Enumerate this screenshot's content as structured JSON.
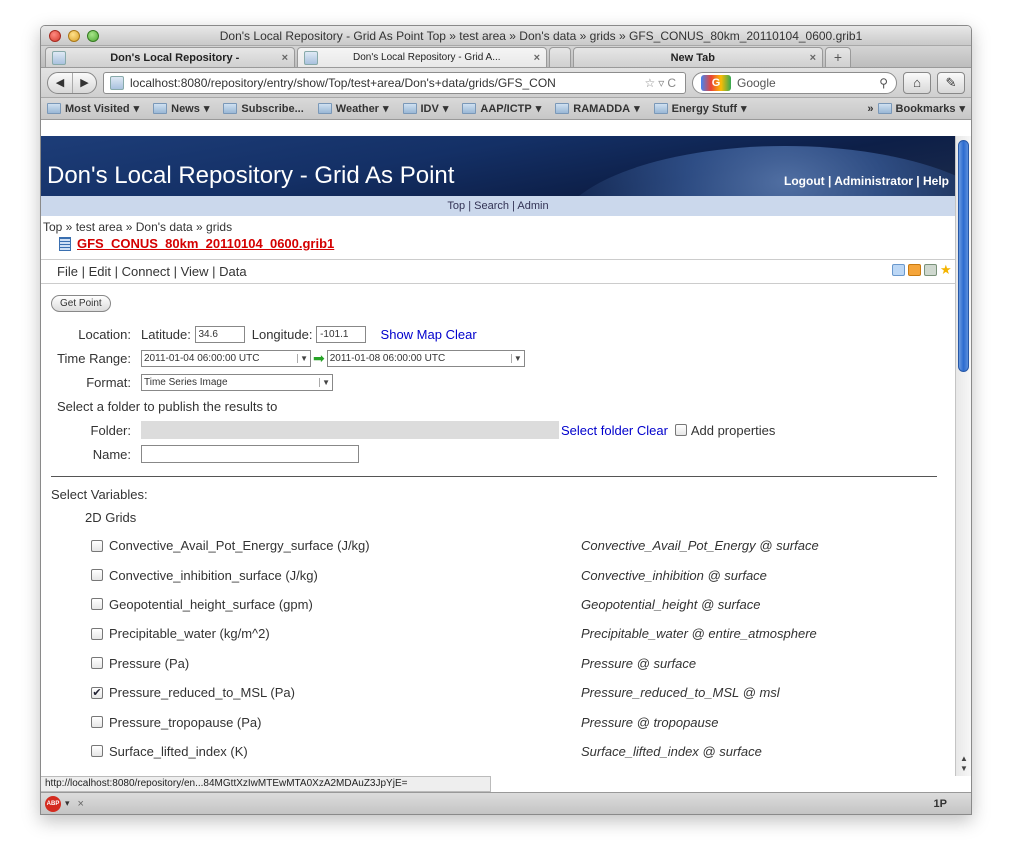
{
  "window": {
    "title": "Don's Local Repository - Grid As Point Top » test area » Don's data » grids » GFS_CONUS_80km_20110104_0600.grib1"
  },
  "tabs": [
    {
      "label": "Don's Local Repository -",
      "active": false
    },
    {
      "label": "Don's Local Repository - Grid A...",
      "active": true
    },
    {
      "label": "New Tab",
      "active": false
    }
  ],
  "nav": {
    "url": "localhost:8080/repository/entry/show/Top/test+area/Don's+data/grids/GFS_CON",
    "search_placeholder": "Google",
    "search_engine": "G"
  },
  "bookmarks": [
    "Most Visited",
    "News",
    "Subscribe...",
    "Weather",
    "IDV",
    "AAP/ICTP",
    "RAMADDA",
    "Energy Stuff"
  ],
  "bookmarks_overflow": "Bookmarks",
  "page": {
    "banner_title": "Don's Local Repository - Grid As Point",
    "banner_links": [
      "Logout",
      "Administrator",
      "Help"
    ],
    "top_menu": [
      "Top",
      "Search",
      "Admin"
    ],
    "breadcrumbs": "Top » test area » Don's data » grids",
    "entry_name": "GFS_CONUS_80km_20110104_0600.grib1",
    "entry_menu": [
      "File",
      "Edit",
      "Connect",
      "View",
      "Data"
    ]
  },
  "form": {
    "get_point_label": "Get Point",
    "location_label": "Location:",
    "latitude_label": "Latitude:",
    "latitude_value": "34.6",
    "longitude_label": "Longitude:",
    "longitude_value": "-101.1",
    "show_map_label": "Show Map",
    "clear_label": "Clear",
    "time_range_label": "Time Range:",
    "time_start": "2011-01-04 06:00:00 UTC",
    "time_end": "2011-01-08 06:00:00 UTC",
    "format_label": "Format:",
    "format_value": "Time Series Image",
    "publish_prompt": "Select a folder to publish the results to",
    "folder_label": "Folder:",
    "select_folder_label": "Select folder",
    "folder_clear_label": "Clear",
    "add_properties_label": "Add properties",
    "name_label": "Name:",
    "select_variables_label": "Select Variables:",
    "group_label": "2D Grids"
  },
  "variables": [
    {
      "name": "Convective_Avail_Pot_Energy_surface (J/kg)",
      "desc": "Convective_Avail_Pot_Energy @ surface",
      "checked": false
    },
    {
      "name": "Convective_inhibition_surface (J/kg)",
      "desc": "Convective_inhibition @ surface",
      "checked": false
    },
    {
      "name": "Geopotential_height_surface (gpm)",
      "desc": "Geopotential_height @ surface",
      "checked": false
    },
    {
      "name": "Precipitable_water (kg/m^2)",
      "desc": "Precipitable_water @ entire_atmosphere",
      "checked": false
    },
    {
      "name": "Pressure (Pa)",
      "desc": "Pressure @ surface",
      "checked": false
    },
    {
      "name": "Pressure_reduced_to_MSL (Pa)",
      "desc": "Pressure_reduced_to_MSL @ msl",
      "checked": true
    },
    {
      "name": "Pressure_tropopause (Pa)",
      "desc": "Pressure @ tropopause",
      "checked": false
    },
    {
      "name": "Surface_lifted_index (K)",
      "desc": "Surface_lifted_index @ surface",
      "checked": false
    }
  ],
  "status": {
    "hover_url": "http://localhost:8080/repository/en...84MGttXzIwMTEwMTA0XzA2MDAuZ3JpYjE=",
    "abp_label": "ABP",
    "close_glyph": "×",
    "right_label": "1P"
  }
}
